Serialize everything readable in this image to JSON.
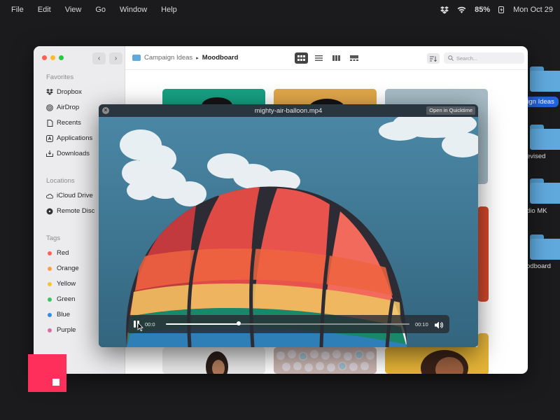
{
  "menubar": {
    "items": [
      "File",
      "Edit",
      "View",
      "Go",
      "Window",
      "Help"
    ],
    "battery": "85%",
    "datetime": "Mon Oct 29"
  },
  "desktop": {
    "labels": [
      {
        "text": "aign Ideas",
        "selected": true
      },
      {
        "text": "evised",
        "selected": false
      },
      {
        "text": "dio MK",
        "selected": false
      },
      {
        "text": "odboard",
        "selected": false
      }
    ]
  },
  "finder": {
    "breadcrumb": {
      "parent": "Campaign Ideas",
      "current": "Moodboard"
    },
    "search_placeholder": "Search...",
    "sidebar": {
      "favorites_title": "Favorites",
      "favorites": [
        "Dropbox",
        "AirDrop",
        "Recents",
        "Applications",
        "Downloads"
      ],
      "locations_title": "Locations",
      "locations": [
        "iCloud Drive",
        "Remote Disc"
      ],
      "tags_title": "Tags",
      "tags": [
        {
          "name": "Red",
          "color": "#ff5f57"
        },
        {
          "name": "Orange",
          "color": "#ff9f43"
        },
        {
          "name": "Yellow",
          "color": "#f5c531"
        },
        {
          "name": "Green",
          "color": "#3cc35f"
        },
        {
          "name": "Blue",
          "color": "#2f8de4"
        },
        {
          "name": "Purple",
          "color": "#d46fa8"
        }
      ]
    }
  },
  "player": {
    "title": "mighty-air-balloon.mp4",
    "open_button": "Open in Quicktime",
    "time_current": "00:0",
    "time_total": "00:10",
    "progress": 0.3
  },
  "colors": {
    "accent": "#2463d6",
    "brand_pink": "#ff2f5c",
    "sky": "#3b6f88"
  }
}
